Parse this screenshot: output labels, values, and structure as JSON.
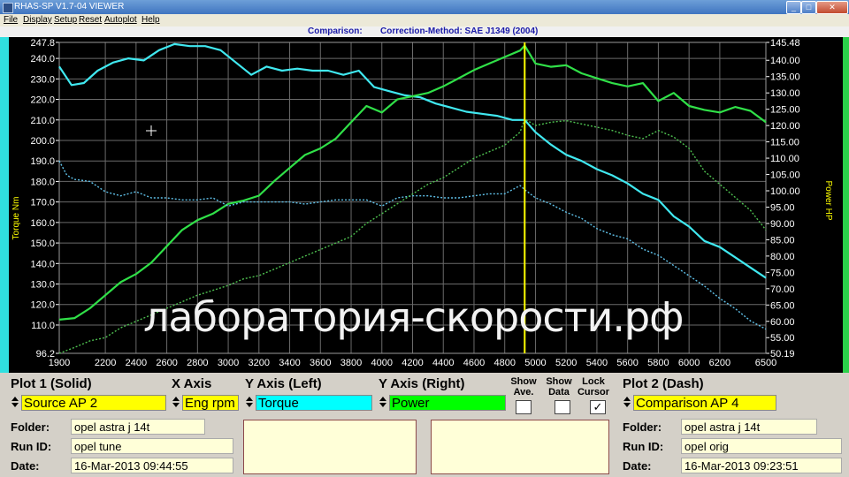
{
  "window": {
    "title": "RHAS-SP V1.7-04  VIEWER"
  },
  "menu": [
    "File",
    "Display",
    "Setup",
    "Reset",
    "Autoplot",
    "Help"
  ],
  "comparison": {
    "label": "Comparison:",
    "method": "Correction-Method: SAE J1349 (2004)"
  },
  "watermark": "лаборатория-скорости.рф",
  "chart_data": {
    "type": "line",
    "xlabel": "",
    "ylabel": "Torque Nm",
    "y2label": "Power HP",
    "xlim": [
      1900,
      6500
    ],
    "ylim": [
      96.2,
      247.8
    ],
    "y2lim": [
      50.19,
      145.48
    ],
    "x_ticks": [
      1900,
      2200,
      2400,
      2600,
      2800,
      3000,
      3200,
      3400,
      3600,
      3800,
      4000,
      4200,
      4400,
      4600,
      4800,
      5000,
      5200,
      5400,
      5600,
      5800,
      6000,
      6200,
      6500
    ],
    "y_ticks": [
      "247.8",
      "240.0",
      "230.0",
      "220.0",
      "210.0",
      "200.0",
      "190.0",
      "180.0",
      "170.0",
      "160.0",
      "150.0",
      "140.0",
      "130.0",
      "120.0",
      "110.0",
      "96.2"
    ],
    "y2_ticks": [
      "145.48",
      "140.00",
      "135.00",
      "130.00",
      "125.00",
      "120.00",
      "115.00",
      "110.00",
      "105.00",
      "100.00",
      "95.00",
      "90.00",
      "85.00",
      "80.00",
      "75.00",
      "70.00",
      "65.00",
      "60.00",
      "55.00",
      "50.19"
    ],
    "cursor_rpm": 4930,
    "grid": true,
    "series": [
      {
        "axis": "left",
        "style": "solid",
        "color": "#40e8f0",
        "x": [
          1900,
          1980,
          2060,
          2150,
          2250,
          2350,
          2450,
          2550,
          2650,
          2750,
          2850,
          2950,
          3050,
          3150,
          3250,
          3350,
          3450,
          3550,
          3650,
          3750,
          3850,
          3950,
          4050,
          4150,
          4250,
          4350,
          4450,
          4550,
          4650,
          4750,
          4850,
          4930,
          5000,
          5100,
          5200,
          5300,
          5400,
          5500,
          5600,
          5700,
          5800,
          5900,
          6000,
          6100,
          6200,
          6300,
          6400,
          6500
        ],
        "y": [
          236,
          227,
          228,
          234,
          238,
          240,
          239,
          244,
          247,
          246,
          246,
          244,
          238,
          232,
          236,
          234,
          235,
          234,
          234,
          232,
          234,
          226,
          224,
          222,
          221,
          218,
          216,
          214,
          213,
          212,
          210,
          210,
          204,
          198,
          193,
          190,
          186,
          183,
          179,
          174,
          171,
          163,
          158,
          151,
          148,
          143,
          138,
          133
        ]
      },
      {
        "axis": "right",
        "style": "solid",
        "color": "#30e048",
        "x": [
          1900,
          2000,
          2100,
          2200,
          2300,
          2400,
          2500,
          2600,
          2700,
          2800,
          2900,
          3000,
          3100,
          3200,
          3300,
          3400,
          3500,
          3600,
          3700,
          3800,
          3900,
          4000,
          4100,
          4200,
          4300,
          4400,
          4500,
          4600,
          4700,
          4800,
          4900,
          4930,
          5000,
          5100,
          5200,
          5300,
          5400,
          5500,
          5600,
          5700,
          5800,
          5900,
          6000,
          6100,
          6200,
          6300,
          6400,
          6500
        ],
        "y": [
          60.5,
          61,
          64,
          68,
          72,
          74.5,
          78,
          83,
          88,
          91,
          93,
          96,
          97,
          98.5,
          103,
          107,
          111,
          113,
          116,
          121,
          126,
          124,
          128,
          129,
          130,
          132,
          134.5,
          137,
          139,
          141,
          143,
          144.5,
          139,
          138,
          138.5,
          136,
          134.5,
          133,
          132,
          133,
          127.5,
          130,
          126,
          124.8,
          124,
          125.7,
          124.5,
          121
        ]
      },
      {
        "axis": "left",
        "style": "dash",
        "color": "#5fc0e8",
        "x": [
          1900,
          1950,
          2000,
          2100,
          2200,
          2300,
          2400,
          2500,
          2600,
          2700,
          2800,
          2900,
          3000,
          3100,
          3200,
          3300,
          3400,
          3500,
          3600,
          3700,
          3800,
          3900,
          4000,
          4100,
          4200,
          4300,
          4400,
          4500,
          4600,
          4700,
          4800,
          4900,
          4930,
          5000,
          5100,
          5200,
          5300,
          5400,
          5500,
          5600,
          5700,
          5800,
          5900,
          6000,
          6100,
          6200,
          6300,
          6400,
          6500
        ],
        "y": [
          190,
          183,
          181,
          180,
          175,
          173,
          175,
          172,
          172,
          171,
          171,
          172,
          168,
          170,
          170,
          170,
          170,
          169,
          170,
          171,
          171,
          171,
          168,
          172,
          173,
          173,
          172,
          172,
          173,
          174,
          174,
          178,
          176,
          172,
          169,
          165,
          162,
          157,
          154,
          152,
          147,
          144,
          139,
          134,
          129,
          123,
          118,
          112,
          108
        ]
      },
      {
        "axis": "right",
        "style": "dash",
        "color": "#4ec050",
        "x": [
          1900,
          2000,
          2100,
          2200,
          2300,
          2400,
          2500,
          2600,
          2700,
          2800,
          2900,
          3000,
          3100,
          3200,
          3300,
          3400,
          3500,
          3600,
          3700,
          3800,
          3900,
          4000,
          4100,
          4200,
          4300,
          4400,
          4500,
          4600,
          4700,
          4800,
          4900,
          4930,
          5000,
          5100,
          5200,
          5300,
          5400,
          5500,
          5600,
          5700,
          5800,
          5900,
          6000,
          6100,
          6200,
          6300,
          6400,
          6500
        ],
        "y": [
          50.2,
          52,
          54,
          55,
          58,
          60,
          62,
          64,
          66,
          68,
          69.5,
          71,
          73,
          74,
          76,
          78,
          80,
          82,
          84,
          86,
          90,
          93,
          96,
          99,
          102,
          104,
          107,
          110,
          112,
          114,
          118,
          122,
          120,
          121,
          121.5,
          120.5,
          119.5,
          118.5,
          117,
          116,
          118.5,
          116.5,
          113,
          106,
          102,
          98,
          94,
          88
        ]
      }
    ]
  },
  "plot1": {
    "heading": "Plot 1 (Solid)",
    "source": "Source AP 2",
    "folder_label": "Folder:",
    "folder": "opel astra j 14t",
    "runid_label": "Run ID:",
    "runid": "opel tune",
    "date_label": "Date:",
    "date": "16-Mar-2013  09:44:55"
  },
  "xaxis": {
    "heading": "X Axis",
    "value": "Eng rpm"
  },
  "yleft": {
    "heading": "Y Axis (Left)",
    "value": "Torque"
  },
  "yright": {
    "heading": "Y Axis (Right)",
    "value": "Power"
  },
  "toggles": {
    "show_ave": "Show\nAve.",
    "show_data": "Show\nData",
    "lock_cursor": "Lock\nCursor",
    "checked": "✓"
  },
  "plot2": {
    "heading": "Plot 2 (Dash)",
    "source": "Comparison AP 4",
    "folder_label": "Folder:",
    "folder": "opel astra j 14t",
    "runid_label": "Run ID:",
    "runid": "opel orig",
    "date_label": "Date:",
    "date": "16-Mar-2013  09:23:51"
  },
  "colors": {
    "torque_field": "#00ffff",
    "power_field": "#00ff00",
    "source_field": "#ffff00",
    "cursor": "#ffff00",
    "grid": "#6a6a6a"
  }
}
